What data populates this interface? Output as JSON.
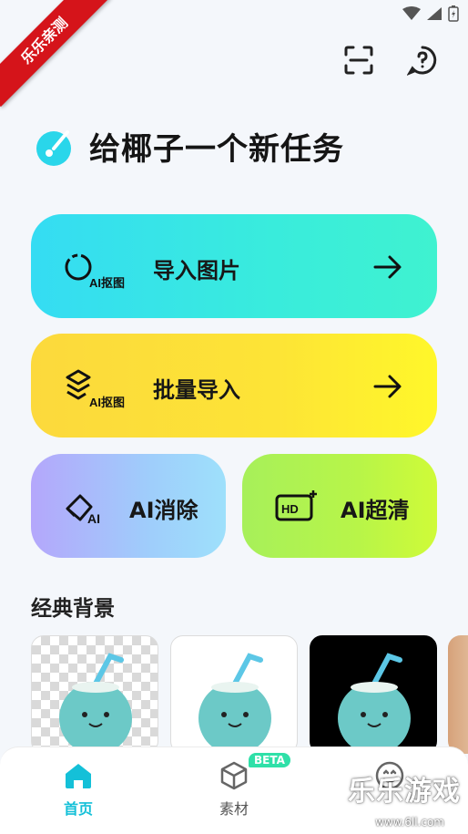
{
  "watermark": {
    "corner": "乐乐亲测",
    "brand": "乐乐游戏",
    "url": "www.6ll.com"
  },
  "header": {
    "title": "给椰子一个新任务",
    "scan_icon": "scan-icon",
    "help_icon": "help-icon"
  },
  "actions": {
    "import": {
      "label": "导入图片",
      "badge": "AI抠图"
    },
    "batch": {
      "label": "批量导入",
      "badge": "AI抠图"
    },
    "erase": {
      "label": "AI消除",
      "badge": "AI"
    },
    "hd": {
      "label": "AI超清",
      "badge": "HD"
    }
  },
  "section": {
    "title": "经典背景"
  },
  "backgrounds": [
    "transparent",
    "white",
    "black",
    "warm-photo"
  ],
  "tabs": [
    {
      "label": "首页",
      "icon": "home-icon",
      "active": true
    },
    {
      "label": "素材",
      "icon": "cube-icon",
      "badge": "BETA",
      "active": false
    },
    {
      "label": "",
      "icon": "smiley-icon",
      "active": false
    }
  ],
  "colors": {
    "accent": "#14c0d8",
    "import_card": "#35dcf3",
    "batch_card": "#fcd93c",
    "erase_card": "#b4a7fb",
    "hd_card": "#a7f05a"
  }
}
